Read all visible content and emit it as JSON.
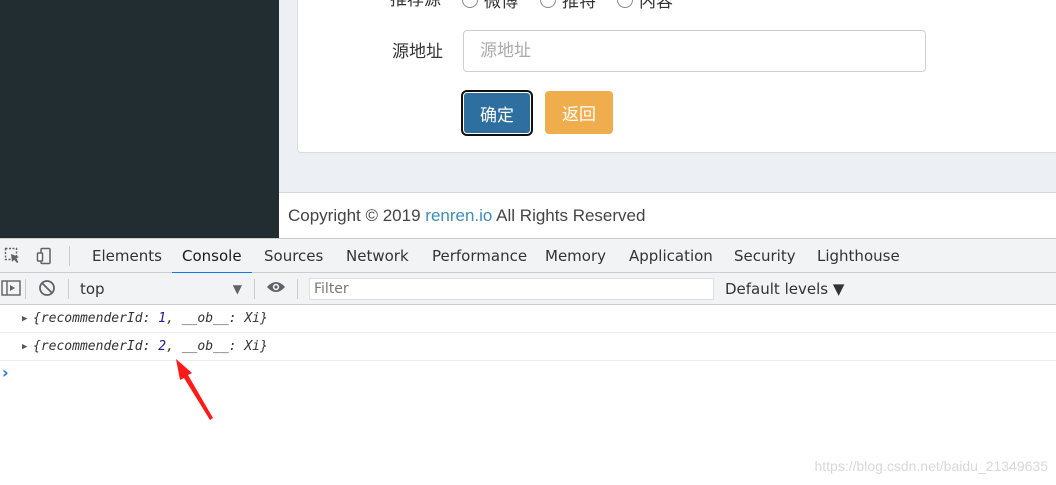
{
  "app": {
    "radio_label": "推荐源",
    "radio_options": [
      "微博",
      "推特",
      "内容"
    ],
    "source_address_label": "源地址",
    "source_address_placeholder": "源地址",
    "source_address_value": "",
    "confirm_button": "确定",
    "back_button": "返回",
    "footer": {
      "prefix": "Copyright © 2019 ",
      "link": "renren.io",
      "suffix": " All Rights Reserved"
    }
  },
  "devtools": {
    "tabs": [
      "Elements",
      "Console",
      "Sources",
      "Network",
      "Performance",
      "Memory",
      "Application",
      "Security",
      "Lighthouse"
    ],
    "active_tab": "Console",
    "context": "top",
    "filter_placeholder": "Filter",
    "levels": "Default levels ▼",
    "logs": [
      {
        "prefix": "{recommenderId: ",
        "value": "1",
        "suffix": ", __ob__: Xi}"
      },
      {
        "prefix": "{recommenderId: ",
        "value": "2",
        "suffix": ", __ob__: Xi}"
      }
    ],
    "prompt": "›"
  },
  "watermark": "https://blog.csdn.net/baidu_21349635",
  "colors": {
    "sidebar": "#222d32",
    "confirm_button": "#2f6fa0",
    "back_button": "#f0ad4e",
    "link": "#3c8dbc",
    "active_tab_underline": "#1a73e8",
    "annotation_arrow": "#ff1a1a"
  }
}
